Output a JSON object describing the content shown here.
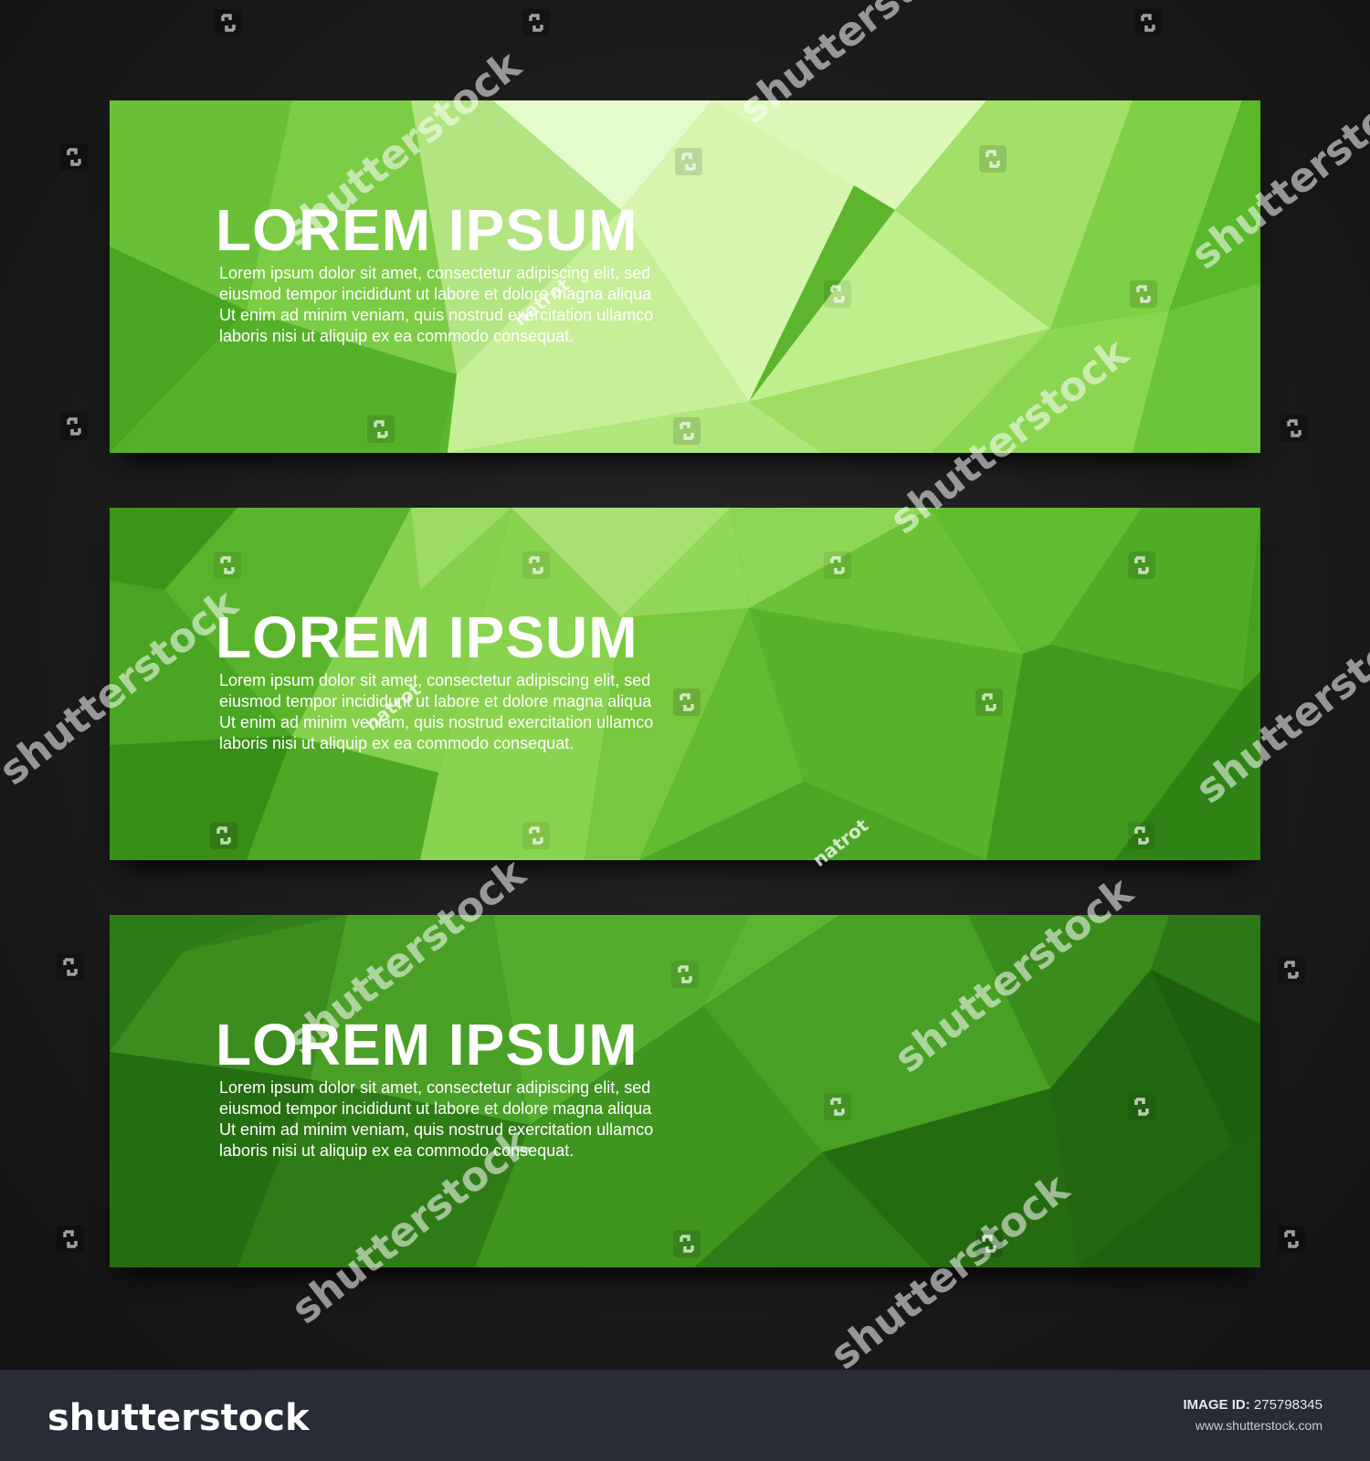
{
  "banners": [
    {
      "title": "LOREM IPSUM",
      "body": [
        "Lorem ipsum dolor sit amet, consectetur adipiscing elit, sed",
        "eiusmod tempor incididunt ut labore et dolore magna aliqua",
        "Ut enim ad minim veniam, quis nostrud exercitation ullamco",
        "laboris nisi ut aliquip ex ea commodo consequat."
      ],
      "colors": [
        "#5aba2c",
        "#8fd650",
        "#cff29c",
        "#e8fbcc",
        "#3f9a1f",
        "#6cc83a"
      ]
    },
    {
      "title": "LOREM IPSUM",
      "body": [
        "Lorem ipsum dolor sit amet, consectetur adipiscing elit, sed",
        "eiusmod tempor incididunt ut labore et dolore magna aliqua",
        "Ut enim ad minim veniam, quis nostrud exercitation ullamco",
        "laboris nisi ut aliquip ex ea commodo consequat."
      ],
      "colors": [
        "#3f9a1f",
        "#66c232",
        "#9fdd6a",
        "#b9e98a",
        "#2f8416",
        "#4faa24"
      ]
    },
    {
      "title": "LOREM IPSUM",
      "body": [
        "Lorem ipsum dolor sit amet, consectetur adipiscing elit, sed",
        "eiusmod tempor incididunt ut labore et dolore magna aliqua",
        "Ut enim ad minim veniam, quis nostrud exercitation ullamco",
        "laboris nisi ut aliquip ex ea commodo consequat."
      ],
      "colors": [
        "#2b7a15",
        "#3c9220",
        "#52ab2c",
        "#62b838",
        "#1e6410",
        "#246c12"
      ]
    }
  ],
  "watermark": {
    "brand": "shutterstock",
    "author": "natrot",
    "icon": "shutterstock-logo-icon"
  },
  "footer": {
    "logo": "shutterstock",
    "image_id_label": "IMAGE ID:",
    "image_id": "275798345",
    "url": "www.shutterstock.com"
  },
  "colors": {
    "background": "#1b1b1b",
    "footer_bg": "#272c36",
    "text": "#ffffff"
  }
}
